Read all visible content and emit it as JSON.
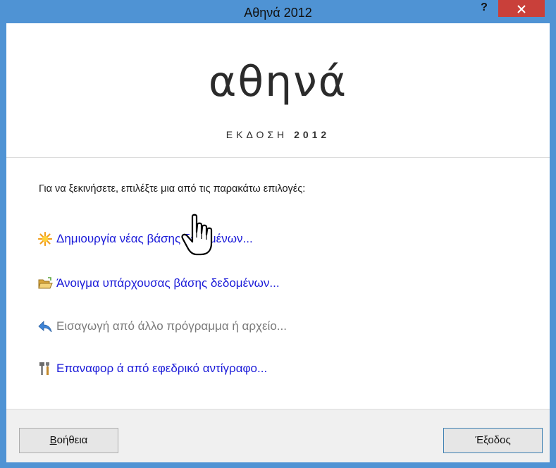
{
  "window": {
    "title": "Αθηνά 2012",
    "help_label": "?",
    "close_label": "×"
  },
  "header": {
    "logo": "αθηνά",
    "edition_label": "ΕΚΔΟΣΗ",
    "edition_year": "2012"
  },
  "content": {
    "prompt": "Για να ξεκινήσετε, επιλέξτε μια από τις παρακάτω επιλογές:",
    "options": [
      {
        "label": "Δημιουργία νέας βάσης δεδομένων...",
        "icon": "sparkle-icon",
        "enabled": true
      },
      {
        "label": "Άνοιγμα υπάρχουσας βάσης δεδομένων...",
        "icon": "open-folder-icon",
        "enabled": true
      },
      {
        "label": "Εισαγωγή από άλλο πρόγραμμα ή αρχείο...",
        "icon": "import-arrow-icon",
        "enabled": false
      },
      {
        "label": "Επαναφορ ά από εφεδρικό αντίγραφο...",
        "icon": "tools-icon",
        "enabled": true
      }
    ]
  },
  "footer": {
    "help_button_first": "Β",
    "help_button_rest": "οήθεια",
    "exit_button": "Έξοδος"
  },
  "colors": {
    "titlebar": "#4f93d4",
    "close": "#c9403a",
    "link": "#1a1ad8",
    "disabled": "#7a7a7a"
  }
}
